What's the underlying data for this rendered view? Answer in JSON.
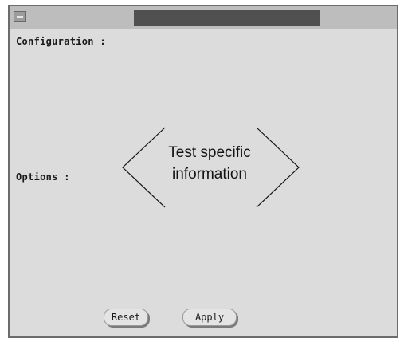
{
  "window": {
    "title": ""
  },
  "sections": {
    "configuration_label": "Configuration :",
    "options_label": "Options :"
  },
  "placeholder": {
    "line1": "Test specific",
    "line2": "information"
  },
  "buttons": {
    "reset_label": "Reset",
    "apply_label": "Apply"
  }
}
